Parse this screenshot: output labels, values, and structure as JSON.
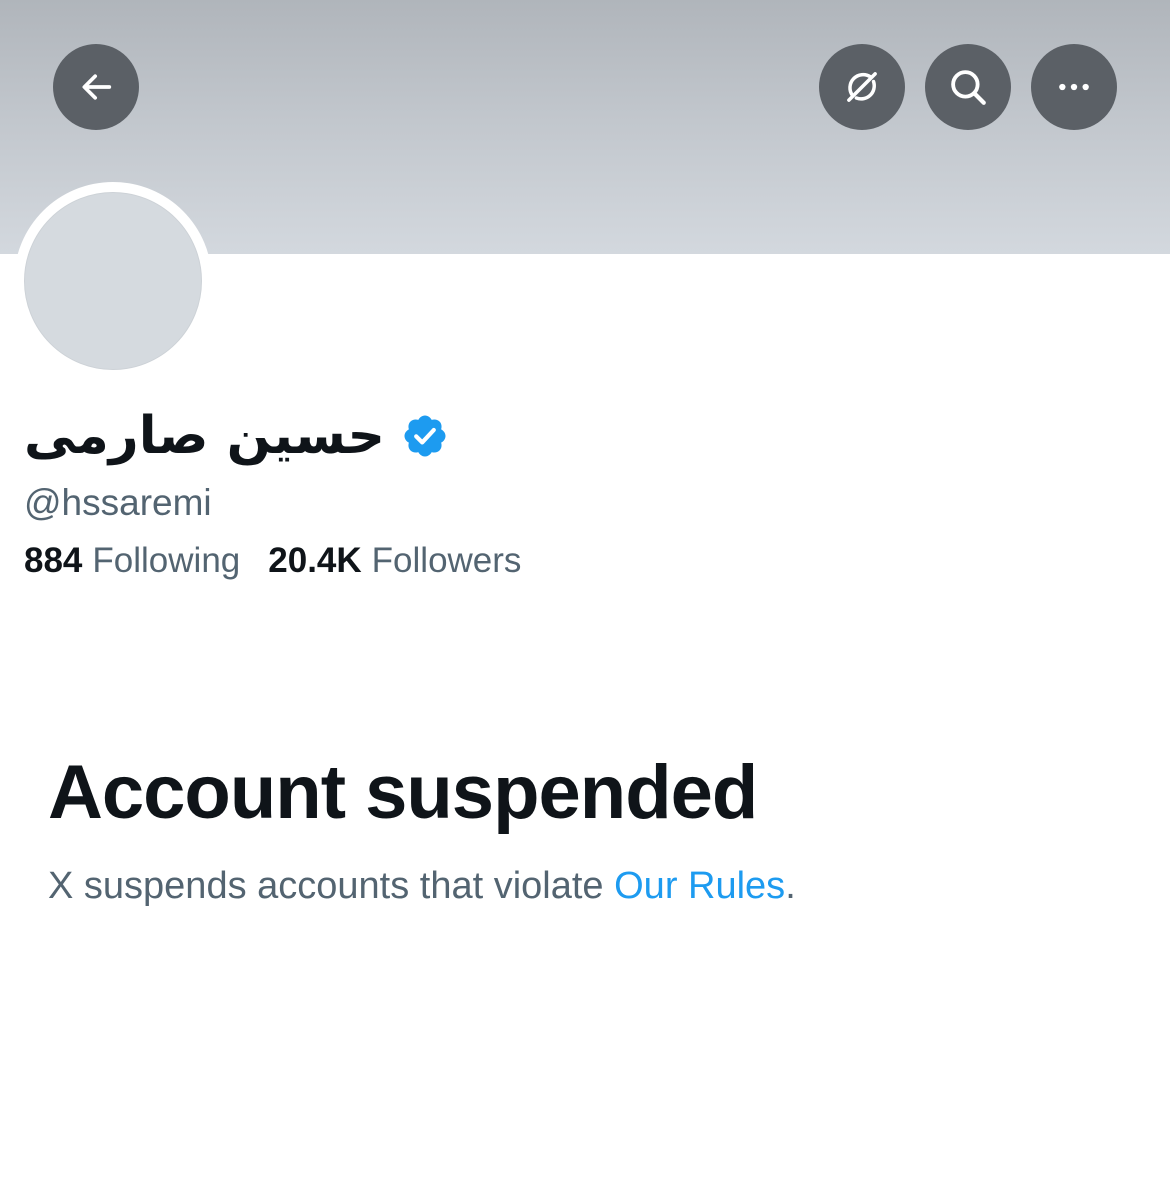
{
  "header": {
    "back_icon": "arrow-left-icon",
    "grok_icon": "grok-icon",
    "search_icon": "search-icon",
    "more_icon": "more-horizontal-icon"
  },
  "profile": {
    "display_name": "حسین صارمی",
    "verified_icon": "verified-badge-icon",
    "handle": "@hssaremi",
    "following_count": "884",
    "following_label": "Following",
    "followers_count": "20.4K",
    "followers_label": "Followers"
  },
  "suspended": {
    "title": "Account suspended",
    "description_prefix": "X suspends accounts that violate ",
    "rules_link": "Our Rules",
    "description_suffix": "."
  },
  "colors": {
    "accent": "#1d9bf0",
    "verified": "#1d9bf0",
    "secondary_text": "#536471",
    "primary_text": "#0f1419",
    "header_button_bg": "#5b6066"
  }
}
